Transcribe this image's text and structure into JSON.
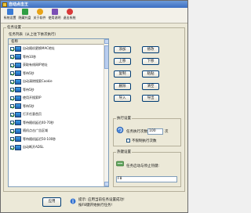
{
  "window": {
    "title": "自动点击王"
  },
  "toolbar": [
    {
      "label": "系统设置",
      "color": "#3a7bd5",
      "icon": "settings-icon"
    },
    {
      "label": "隐藏托盘",
      "color": "#2f9e44",
      "icon": "tray-icon"
    },
    {
      "label": "关于软件",
      "color": "#e8a317",
      "icon": "info-icon"
    },
    {
      "label": "使用说明",
      "color": "#7b4fb5",
      "icon": "help-icon"
    },
    {
      "label": "退出系统",
      "color": "#d93a3a",
      "icon": "exit-icon"
    }
  ],
  "task_group": {
    "legend": "任务设置",
    "list_caption": "任务列表（从上往下依次执行）",
    "column_header": "名称",
    "rows": [
      {
        "text": "自动随机更换MAC地址",
        "checked": true,
        "selected": false
      },
      {
        "text": "等待10秒",
        "checked": true,
        "selected": false
      },
      {
        "text": "获取有线网IP地址",
        "checked": true,
        "selected": false
      },
      {
        "text": "等待5秒",
        "checked": true,
        "selected": false
      },
      {
        "text": "自动清除搜索Cookie",
        "checked": true,
        "selected": false
      },
      {
        "text": "等待5秒",
        "checked": true,
        "selected": false
      },
      {
        "text": "使用开搜索IP",
        "checked": true,
        "selected": false
      },
      {
        "text": "等待5秒",
        "checked": true,
        "selected": false
      },
      {
        "text": "打开任意首页",
        "checked": true,
        "selected": false
      },
      {
        "text": "等待随机延迟40-70秒",
        "checked": true,
        "selected": false
      },
      {
        "text": "随机点击广告区域",
        "checked": true,
        "selected": false
      },
      {
        "text": "等待随机延迟50-100秒",
        "checked": true,
        "selected": false
      },
      {
        "text": "自动断开ADSL",
        "checked": true,
        "selected": false
      }
    ]
  },
  "side_buttons": {
    "add": "添加",
    "edit": "修改",
    "up": "上移",
    "down": "下移",
    "copy": "复制",
    "paste": "粘贴",
    "delete": "删除",
    "clear": "清空",
    "import": "导入",
    "export": "导出"
  },
  "exec_group": {
    "legend": "执行设置",
    "count_label": "任务执行次数:",
    "count_value": "100",
    "count_unit": "次",
    "unlimited_label": "不限制执行次数",
    "unlimited_checked": false
  },
  "hotkey_group": {
    "legend": "热键设置",
    "label": "任务启动与停止热键:",
    "value": "F8"
  },
  "footer": {
    "apply_button": "应用",
    "hint_line1": "提示: 应用当前任务设置成功!",
    "hint_line2": "按F8键开始执行任务!"
  }
}
